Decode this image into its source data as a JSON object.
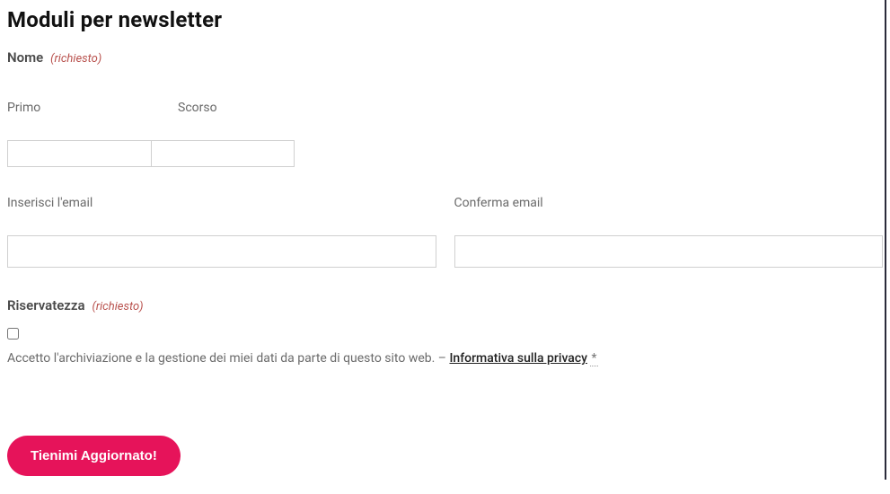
{
  "heading": "Moduli per newsletter",
  "name": {
    "label": "Nome",
    "required_text": "(richiesto)",
    "first_sublabel": "Primo",
    "last_sublabel": "Scorso",
    "first_value": "",
    "last_value": ""
  },
  "email": {
    "enter_label": "Inserisci l'email",
    "confirm_label": "Conferma email",
    "enter_value": "",
    "confirm_value": ""
  },
  "privacy": {
    "label": "Riservatezza",
    "required_text": "(richiesto)",
    "consent_text": "Accetto l'archiviazione e la gestione dei miei dati da parte di questo sito web.",
    "separator": " – ",
    "link_text": "Informativa sulla privacy",
    "asterisk": "*"
  },
  "submit": {
    "label": "Tienimi Aggiornato!"
  }
}
